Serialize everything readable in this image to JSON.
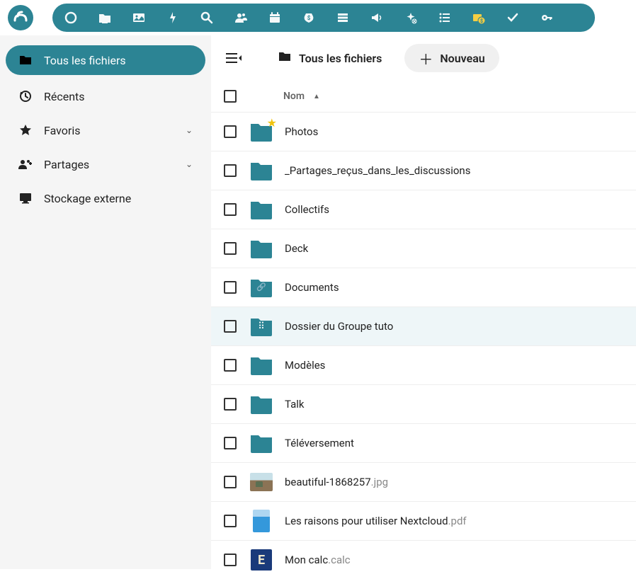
{
  "app": {
    "toolbar_icons": [
      "dashboard",
      "files",
      "photos",
      "activity",
      "search",
      "contacts",
      "calendar",
      "budget",
      "deck",
      "announce",
      "magic",
      "list",
      "money",
      "tasks",
      "passwords"
    ]
  },
  "sidebar": {
    "items": [
      {
        "icon": "folder",
        "label": "Tous les fichiers",
        "active": true
      },
      {
        "icon": "clock",
        "label": "Récents"
      },
      {
        "icon": "star",
        "label": "Favoris",
        "expandable": true
      },
      {
        "icon": "share",
        "label": "Partages",
        "expandable": true
      },
      {
        "icon": "monitor",
        "label": "Stockage externe"
      }
    ]
  },
  "content": {
    "breadcrumb": "Tous les fichiers",
    "new_button": "Nouveau",
    "column_name": "Nom"
  },
  "files": [
    {
      "type": "folder",
      "name": "Photos",
      "starred": true
    },
    {
      "type": "folder",
      "name": "_Partages_reçus_dans_les_discussions"
    },
    {
      "type": "folder",
      "name": "Collectifs"
    },
    {
      "type": "folder",
      "name": "Deck"
    },
    {
      "type": "folder",
      "name": "Documents",
      "overlay": "link"
    },
    {
      "type": "folder",
      "name": "Dossier du Groupe tuto",
      "overlay": "group",
      "hovered": true
    },
    {
      "type": "folder",
      "name": "Modèles"
    },
    {
      "type": "folder",
      "name": "Talk"
    },
    {
      "type": "folder",
      "name": "Téléversement"
    },
    {
      "type": "image",
      "name": "beautiful-1868257",
      "ext": ".jpg"
    },
    {
      "type": "pdf",
      "name": "Les raisons pour utiliser Nextcloud",
      "ext": ".pdf"
    },
    {
      "type": "calc",
      "name": "Mon calc",
      "ext": ".calc"
    }
  ]
}
